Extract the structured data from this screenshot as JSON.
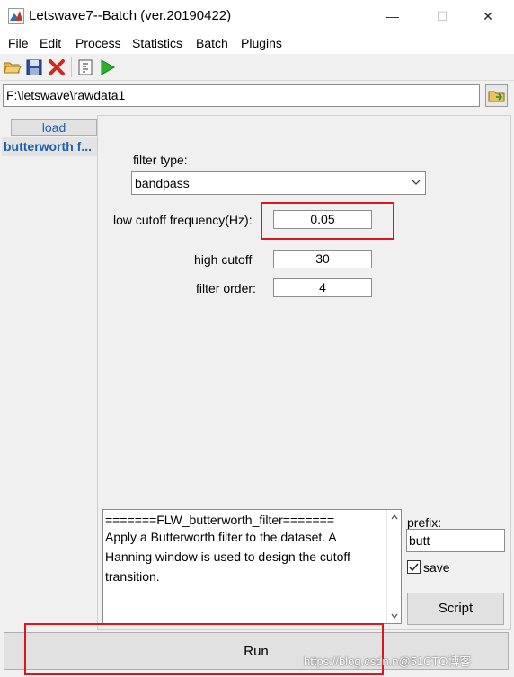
{
  "window": {
    "title": "Letswave7--Batch (ver.20190422)",
    "controls": {
      "minimize": "—",
      "maximize": "☐",
      "close": "✕"
    }
  },
  "menu": {
    "items": [
      "File",
      "Edit",
      "Process",
      "Statistics",
      "Batch",
      "Plugins"
    ]
  },
  "toolbar": {
    "icons": [
      "open-folder-icon",
      "save-disk-icon",
      "delete-x-icon",
      "script-icon",
      "run-play-icon"
    ]
  },
  "path": {
    "value": "F:\\letswave\\rawdata1"
  },
  "left_panel": {
    "load_label": "load",
    "step_label": "butterworth f..."
  },
  "filter": {
    "type_label": "filter type:",
    "type_value": "bandpass",
    "low_cutoff_label": "low cutoff frequency(Hz):",
    "low_cutoff_value": "0.05",
    "high_cutoff_label": "high cutoff",
    "high_cutoff_value": "30",
    "order_label": "filter order:",
    "order_value": "4"
  },
  "description": {
    "header": "=======FLW_butterworth_filter=======",
    "body": "Apply a Butterworth filter to the dataset. A Hanning window is used to design the cutoff transition."
  },
  "options": {
    "prefix_label": "prefix:",
    "prefix_value": "butt",
    "save_label": "save",
    "save_checked": true,
    "script_label": "Script"
  },
  "run": {
    "label": "Run"
  },
  "watermark": "https://blog.csdn.n@51CTO博客",
  "colors": {
    "accent_blue": "#1c5fb0",
    "highlight_red": "#e0141e"
  }
}
